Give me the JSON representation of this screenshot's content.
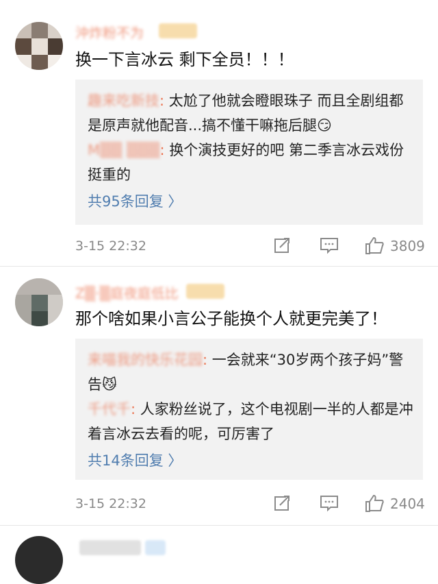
{
  "comments": [
    {
      "username": "沖炸粉不为",
      "content": "换一下言冰云 剩下全员！！！",
      "replies": [
        {
          "name": "趣来吃新技",
          "text": "太尬了他就会瞪眼珠子 而且全剧组都是原声就他配音...搞不懂干嘛拖后腿😏"
        },
        {
          "name": "M▒▒ ▒▒▒",
          "text": "换个演技更好的吧 第二季言冰云戏份挺重的"
        }
      ],
      "more_replies": "共95条回复 〉",
      "time": "3-15 22:32",
      "like_count": "3809",
      "icons": {
        "repost": "repost-icon",
        "comment": "comment-icon",
        "like": "like-icon"
      }
    },
    {
      "username": "Z▒·▒庭夜庭低比",
      "content": "那个啥如果小言公子能换个人就更完美了！",
      "replies": [
        {
          "name": "来喵我的快乐花园",
          "text": "一会就来“30岁两个孩子妈”警告😼"
        },
        {
          "name": "千代千",
          "text": "人家粉丝说了，这个电视剧一半的人都是冲着言冰云去看的呢，可厉害了"
        }
      ],
      "more_replies": "共14条回复 〉",
      "time": "3-15 22:32",
      "like_count": "2404",
      "icons": {
        "repost": "repost-icon",
        "comment": "comment-icon",
        "like": "like-icon"
      }
    }
  ],
  "colors": {
    "username": "#eb7350",
    "link": "#507daf",
    "reply_bg": "#f2f2f2",
    "meta": "#888888"
  }
}
